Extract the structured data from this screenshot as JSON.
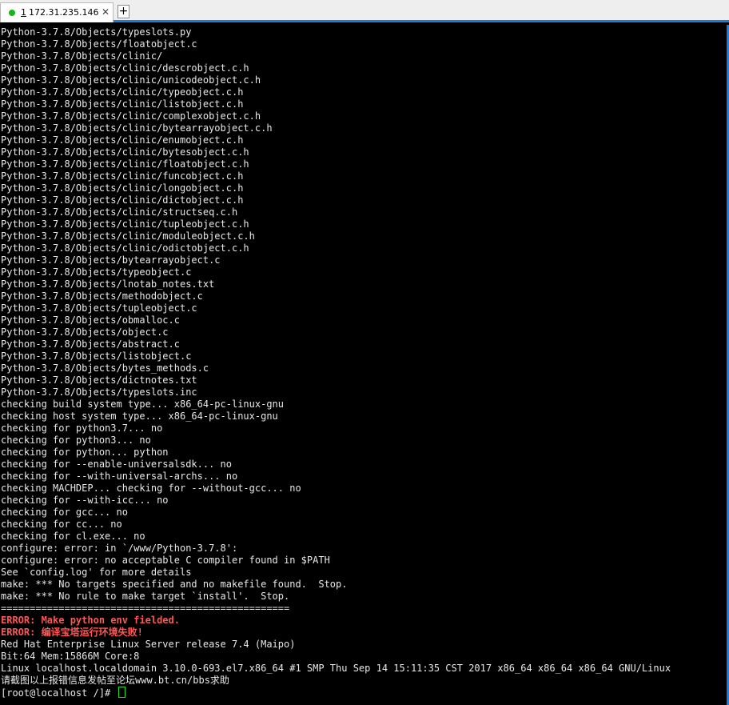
{
  "tab": {
    "index": "1",
    "label": "172.31.235.146",
    "close": "✕",
    "new_tab": "+"
  },
  "colors": {
    "background": "#000000",
    "text": "#e8e8e8",
    "error": "#ff5555",
    "status": "#19b619",
    "accent": "#1f7bd6"
  },
  "terminal": {
    "lines": [
      {
        "text": "Python-3.7.8/Objects/typeslots.py"
      },
      {
        "text": "Python-3.7.8/Objects/floatobject.c"
      },
      {
        "text": "Python-3.7.8/Objects/clinic/"
      },
      {
        "text": "Python-3.7.8/Objects/clinic/descrobject.c.h"
      },
      {
        "text": "Python-3.7.8/Objects/clinic/unicodeobject.c.h"
      },
      {
        "text": "Python-3.7.8/Objects/clinic/typeobject.c.h"
      },
      {
        "text": "Python-3.7.8/Objects/clinic/listobject.c.h"
      },
      {
        "text": "Python-3.7.8/Objects/clinic/complexobject.c.h"
      },
      {
        "text": "Python-3.7.8/Objects/clinic/bytearrayobject.c.h"
      },
      {
        "text": "Python-3.7.8/Objects/clinic/enumobject.c.h"
      },
      {
        "text": "Python-3.7.8/Objects/clinic/bytesobject.c.h"
      },
      {
        "text": "Python-3.7.8/Objects/clinic/floatobject.c.h"
      },
      {
        "text": "Python-3.7.8/Objects/clinic/funcobject.c.h"
      },
      {
        "text": "Python-3.7.8/Objects/clinic/longobject.c.h"
      },
      {
        "text": "Python-3.7.8/Objects/clinic/dictobject.c.h"
      },
      {
        "text": "Python-3.7.8/Objects/clinic/structseq.c.h"
      },
      {
        "text": "Python-3.7.8/Objects/clinic/tupleobject.c.h"
      },
      {
        "text": "Python-3.7.8/Objects/clinic/moduleobject.c.h"
      },
      {
        "text": "Python-3.7.8/Objects/clinic/odictobject.c.h"
      },
      {
        "text": "Python-3.7.8/Objects/bytearrayobject.c"
      },
      {
        "text": "Python-3.7.8/Objects/typeobject.c"
      },
      {
        "text": "Python-3.7.8/Objects/lnotab_notes.txt"
      },
      {
        "text": "Python-3.7.8/Objects/methodobject.c"
      },
      {
        "text": "Python-3.7.8/Objects/tupleobject.c"
      },
      {
        "text": "Python-3.7.8/Objects/obmalloc.c"
      },
      {
        "text": "Python-3.7.8/Objects/object.c"
      },
      {
        "text": "Python-3.7.8/Objects/abstract.c"
      },
      {
        "text": "Python-3.7.8/Objects/listobject.c"
      },
      {
        "text": "Python-3.7.8/Objects/bytes_methods.c"
      },
      {
        "text": "Python-3.7.8/Objects/dictnotes.txt"
      },
      {
        "text": "Python-3.7.8/Objects/typeslots.inc"
      },
      {
        "text": "checking build system type... x86_64-pc-linux-gnu"
      },
      {
        "text": "checking host system type... x86_64-pc-linux-gnu"
      },
      {
        "text": "checking for python3.7... no"
      },
      {
        "text": "checking for python3... no"
      },
      {
        "text": "checking for python... python"
      },
      {
        "text": "checking for --enable-universalsdk... no"
      },
      {
        "text": "checking for --with-universal-archs... no"
      },
      {
        "text": "checking MACHDEP... checking for --without-gcc... no"
      },
      {
        "text": "checking for --with-icc... no"
      },
      {
        "text": "checking for gcc... no"
      },
      {
        "text": "checking for cc... no"
      },
      {
        "text": "checking for cl.exe... no"
      },
      {
        "text": "configure: error: in `/www/Python-3.7.8':"
      },
      {
        "text": "configure: error: no acceptable C compiler found in $PATH"
      },
      {
        "text": "See `config.log' for more details"
      },
      {
        "text": "make: *** No targets specified and no makefile found.  Stop."
      },
      {
        "text": "make: *** No rule to make target `install'.  Stop."
      },
      {
        "text": "=================================================="
      },
      {
        "text": "ERROR: Make python env fielded.",
        "error": true
      },
      {
        "text": "ERROR: 编译宝塔运行环境失败!",
        "error": true
      },
      {
        "text": "Red Hat Enterprise Linux Server release 7.4 (Maipo)"
      },
      {
        "text": "Bit:64 Mem:15866M Core:8"
      },
      {
        "text": "Linux localhost.localdomain 3.10.0-693.el7.x86_64 #1 SMP Thu Sep 14 15:11:35 CST 2017 x86_64 x86_64 x86_64 GNU/Linux"
      },
      {
        "text": "请截图以上报错信息发帖至论坛www.bt.cn/bbs求助"
      }
    ],
    "prompt": "[root@localhost /]# "
  }
}
